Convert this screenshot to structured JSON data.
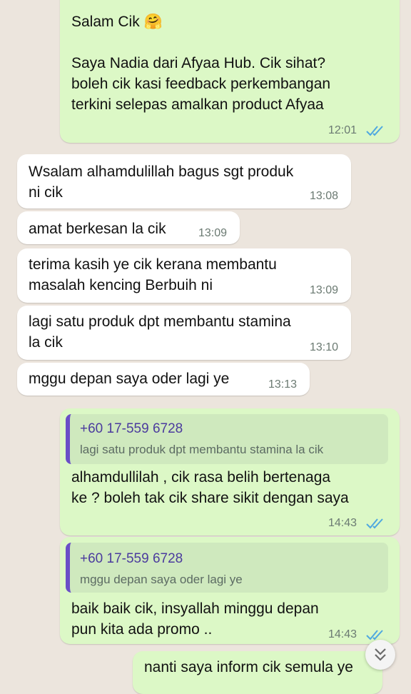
{
  "messages": [
    {
      "id": "m1",
      "dir": "out",
      "text": "Salam Cik 🤗\n\nSaya Nadia dari Afyaa Hub. Cik sihat?\nboleh cik kasi feedback perkembangan\nterkini selepas amalkan product Afyaa",
      "time": "12:01",
      "ticks": "read"
    },
    {
      "id": "m2",
      "dir": "in",
      "text": "Wsalam alhamdulillah bagus sgt produk\nni cik",
      "time": "13:08"
    },
    {
      "id": "m3",
      "dir": "in",
      "text": "amat berkesan la cik",
      "time": "13:09"
    },
    {
      "id": "m4",
      "dir": "in",
      "text": "terima kasih ye cik kerana membantu\nmasalah kencing Berbuih ni",
      "time": "13:09"
    },
    {
      "id": "m5",
      "dir": "in",
      "text": "lagi satu produk dpt membantu stamina\nla cik",
      "time": "13:10"
    },
    {
      "id": "m6",
      "dir": "in",
      "text": "mggu depan saya oder lagi ye",
      "time": "13:13"
    },
    {
      "id": "m7",
      "dir": "out",
      "quote": {
        "sender": "+60 17-559 6728",
        "text": "lagi satu produk dpt membantu stamina la cik"
      },
      "text": "alhamdullilah , cik rasa belih bertenaga\nke ? boleh tak cik share sikit dengan saya",
      "time": "14:43",
      "ticks": "read"
    },
    {
      "id": "m8",
      "dir": "out",
      "quote": {
        "sender": "+60 17-559 6728",
        "text": "mggu depan saya oder lagi ye"
      },
      "text": "baik baik cik, insyallah minggu depan\npun kita ada promo ..",
      "time": "14:43",
      "ticks": "read"
    },
    {
      "id": "m9",
      "dir": "out",
      "text": "nanti saya inform cik semula ye",
      "time": ""
    }
  ],
  "colors": {
    "outgoing": "#dcf8c6",
    "incoming": "#ffffff",
    "read_ticks": "#4fa8e0",
    "quote_bar": "#6a4fc7"
  },
  "icons": {
    "read_ticks": "double-check-icon",
    "scroll_down": "chevron-double-down-icon"
  }
}
